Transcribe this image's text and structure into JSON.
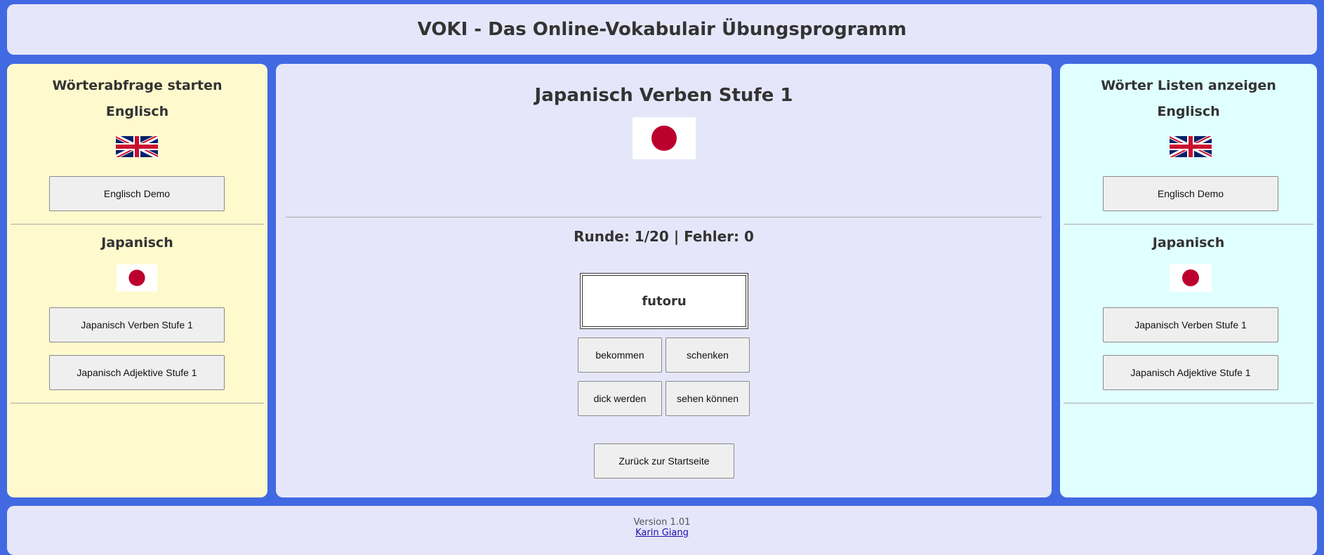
{
  "header": {
    "title": "VOKI - Das Online-Vokabulair Übungsprogramm"
  },
  "left": {
    "title": "Wörterabfrage starten",
    "english": {
      "label": "Englisch",
      "flag": "uk-flag-icon",
      "buttons": [
        "Englisch Demo"
      ]
    },
    "japanese": {
      "label": "Japanisch",
      "flag": "japan-flag-icon",
      "buttons": [
        "Japanisch Verben Stufe 1",
        "Japanisch Adjektive Stufe 1"
      ]
    }
  },
  "center": {
    "title": "Japanisch Verben Stufe 1",
    "flag": "japan-flag-icon",
    "status": "Runde: 1/20 | Fehler: 0",
    "word": "futoru",
    "answers": [
      "bekommen",
      "schenken",
      "dick werden",
      "sehen können"
    ],
    "back_button": "Zurück zur Startseite"
  },
  "right": {
    "title": "Wörter Listen anzeigen",
    "english": {
      "label": "Englisch",
      "flag": "uk-flag-icon",
      "buttons": [
        "Englisch Demo"
      ]
    },
    "japanese": {
      "label": "Japanisch",
      "flag": "japan-flag-icon",
      "buttons": [
        "Japanisch Verben Stufe 1",
        "Japanisch Adjektive Stufe 1"
      ]
    }
  },
  "footer": {
    "version": "Version 1.01",
    "author": "Karin Giang"
  },
  "colors": {
    "background": "#4169e1",
    "header_bg": "#e6e6fa",
    "left_bg": "#fffacd",
    "right_bg": "#e0ffff",
    "japan_red": "#bc002d",
    "uk_blue": "#012169",
    "uk_red": "#c8102e"
  }
}
